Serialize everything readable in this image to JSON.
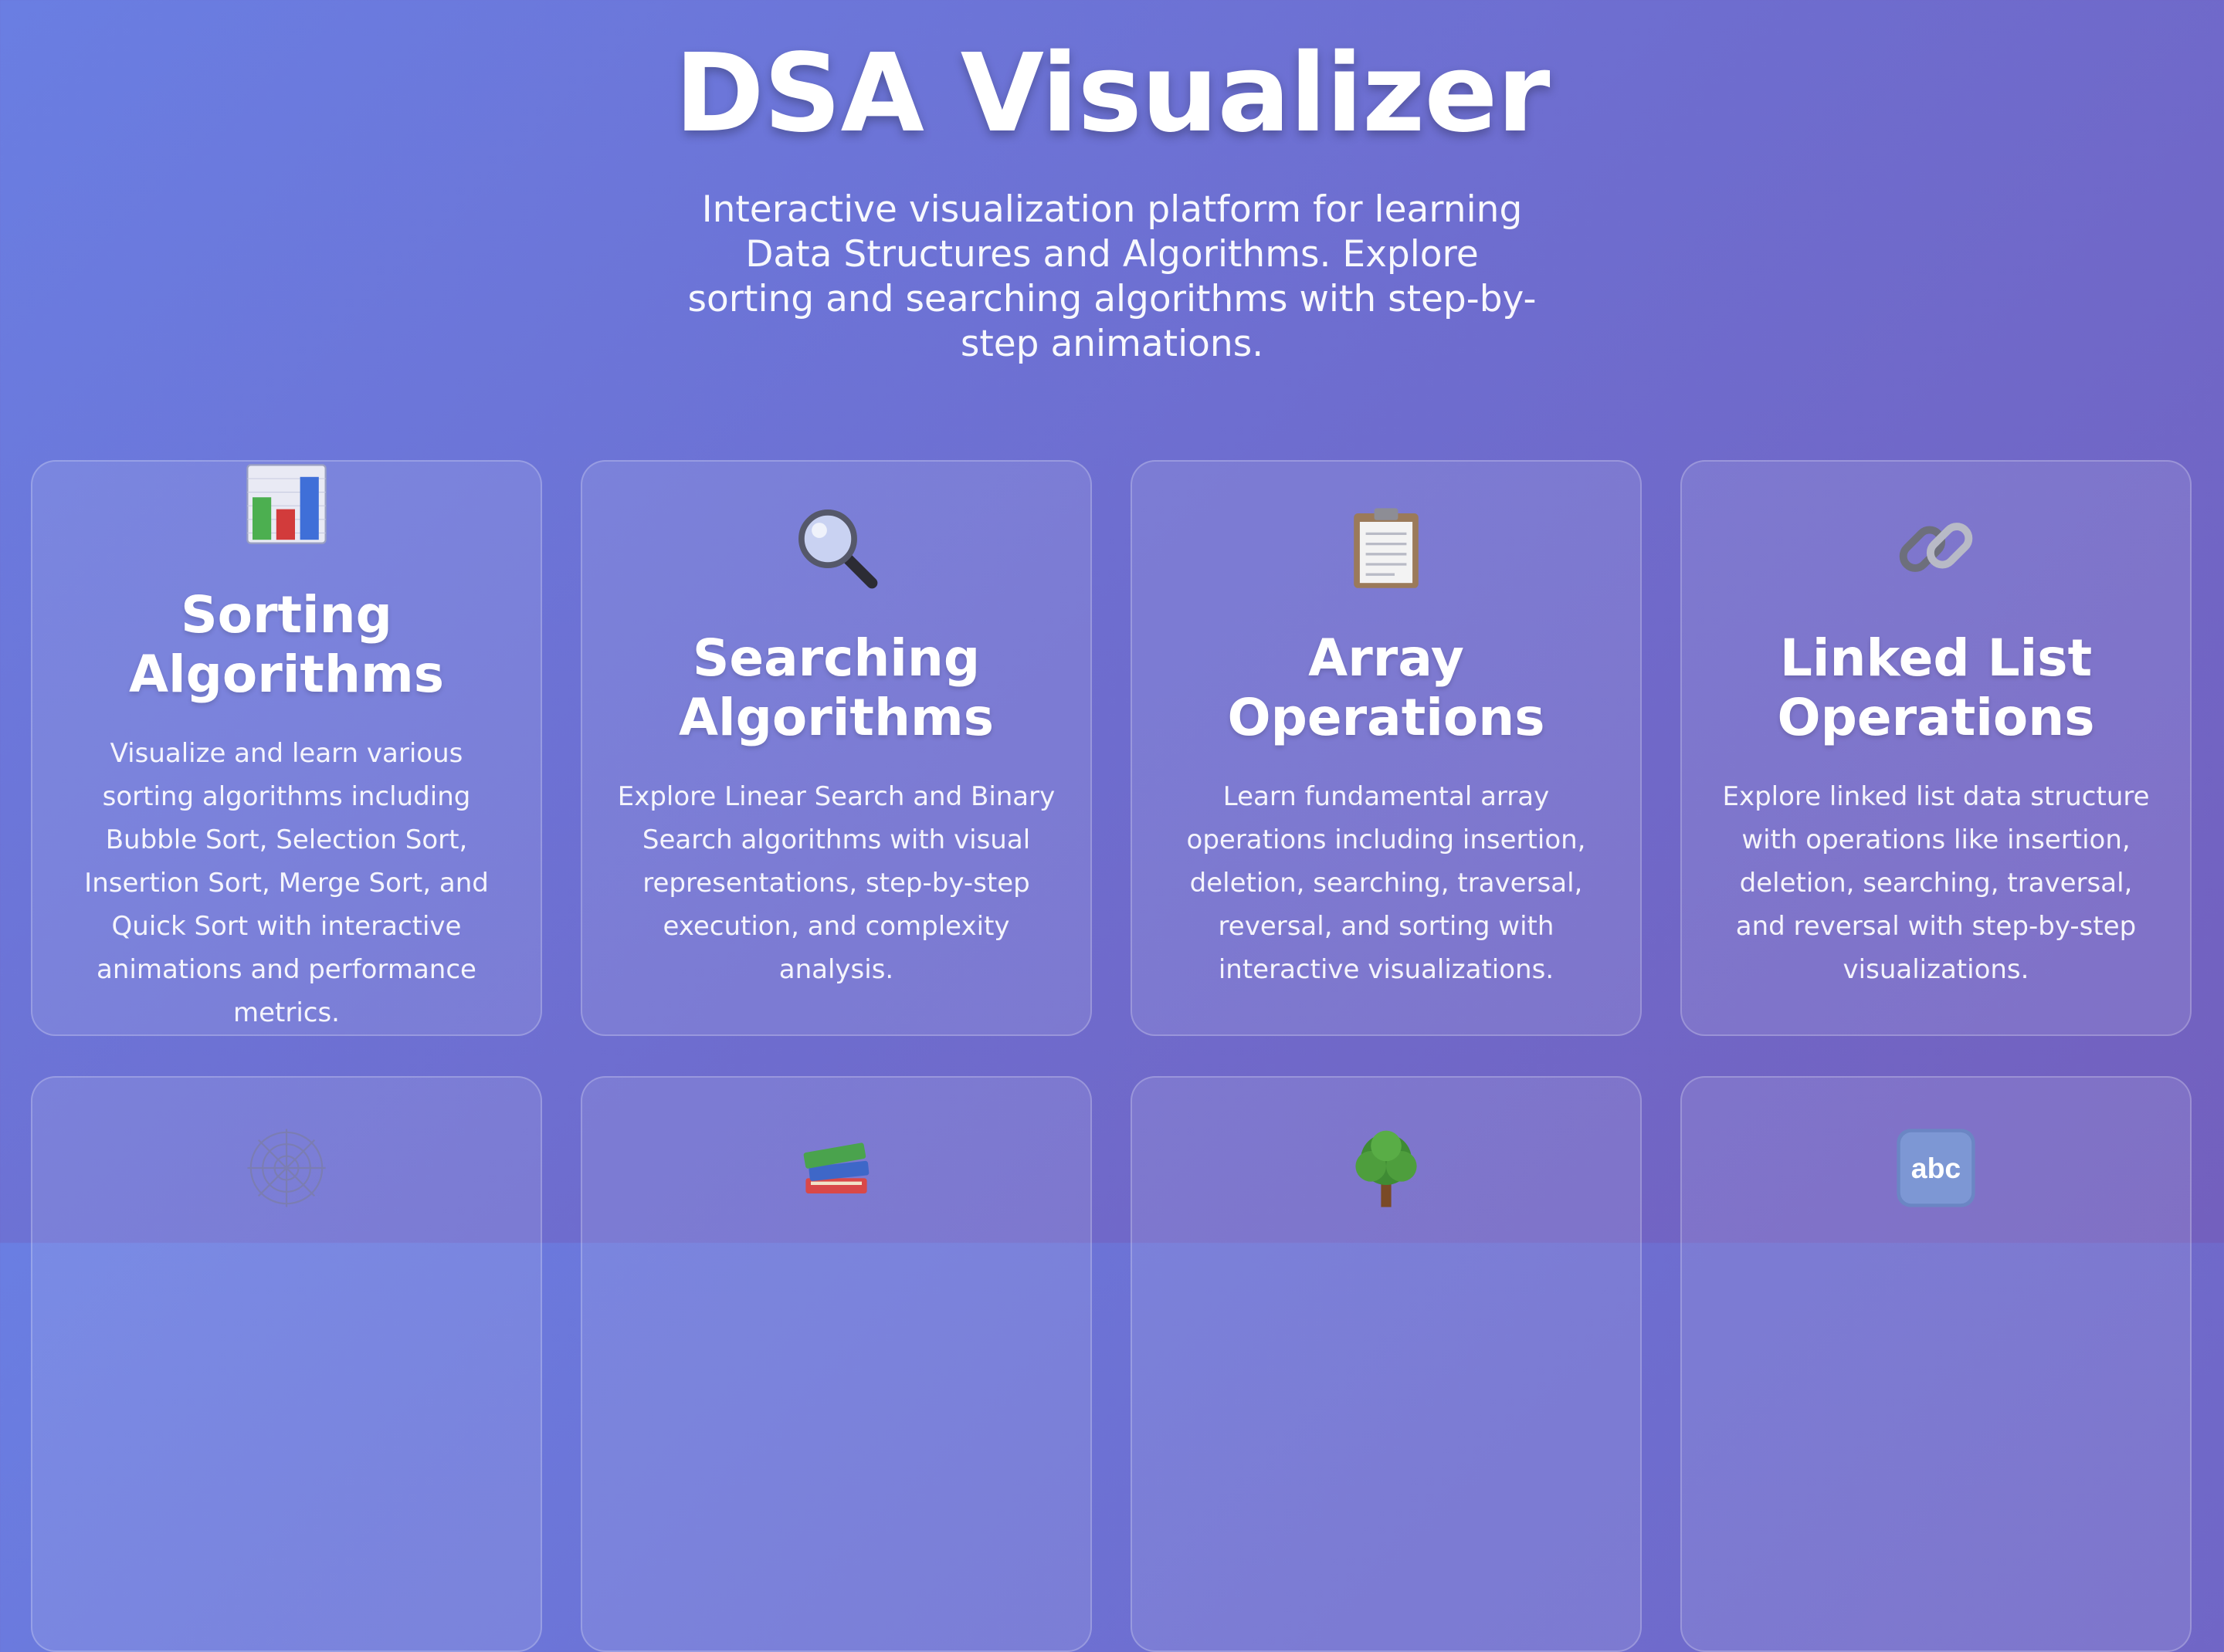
{
  "header": {
    "title": "DSA Visualizer",
    "subtitle": "Interactive visualization platform for learning Data Structures and Algorithms. Explore sorting and searching algorithms with step-by-step animations."
  },
  "cards": [
    {
      "icon": "bar-chart-icon",
      "title": "Sorting Algorithms",
      "description": "Visualize and learn various sorting algorithms including Bubble Sort, Selection Sort, Insertion Sort, Merge Sort, and Quick Sort with interactive animations and performance metrics."
    },
    {
      "icon": "magnifying-glass-icon",
      "title": "Searching Algorithms",
      "description": "Explore Linear Search and Binary Search algorithms with visual representations, step-by-step execution, and complexity analysis."
    },
    {
      "icon": "clipboard-icon",
      "title": "Array Operations",
      "description": "Learn fundamental array operations including insertion, deletion, searching, traversal, reversal, and sorting with interactive visualizations."
    },
    {
      "icon": "link-icon",
      "title": "Linked List Operations",
      "description": "Explore linked list data structure with operations like insertion, deletion, searching, traversal, and reversal with step-by-step visualizations."
    },
    {
      "icon": "spider-web-icon"
    },
    {
      "icon": "books-icon"
    },
    {
      "icon": "tree-icon"
    },
    {
      "icon": "abc-icon",
      "icon_text": "abc"
    }
  ]
}
